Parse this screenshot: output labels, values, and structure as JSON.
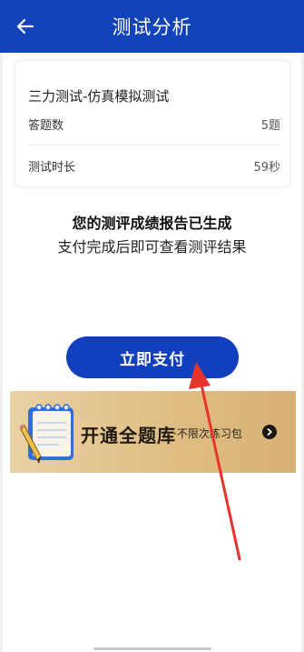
{
  "header": {
    "title": "测试分析",
    "back_icon": "arrow-left-icon"
  },
  "card": {
    "test_name": "三力测试-仿真模拟测试",
    "rows": [
      {
        "label": "答题数",
        "value": "5题"
      },
      {
        "label": "测试时长",
        "value": "59秒"
      }
    ]
  },
  "message": {
    "main": "您的测评成绩报告已生成",
    "sub": "支付完成后即可查看测评结果"
  },
  "pay_button": {
    "label": "立即支付"
  },
  "banner": {
    "headline": "开通全题库",
    "subtitle": "·不限次练习包",
    "icon": "notepad-pencil-icon",
    "arrow_icon": "chevron-right-icon"
  },
  "colors": {
    "header_bg": "#1343b8",
    "button_bg": "#123fbe",
    "annotation_arrow": "#e8322d",
    "banner_bg": "#dfbd82"
  }
}
